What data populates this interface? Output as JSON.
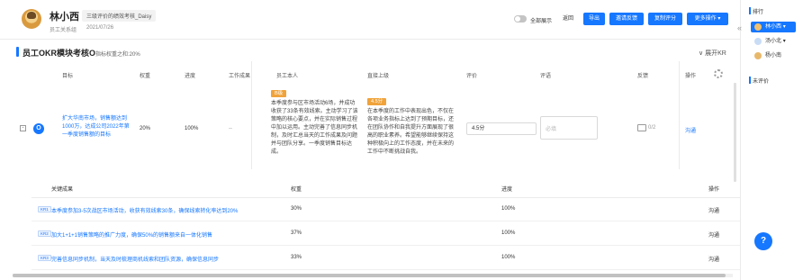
{
  "header": {
    "name": "林小西",
    "cycle_tag": "三级评价的绩效考核_Daisy",
    "dept": "员工关系组",
    "date": "2021/07/26",
    "toggle_label": "全部展示",
    "back_label": "返回",
    "export_label": "导出",
    "invite_label": "邀请反馈",
    "copy_label": "复制评分",
    "more_label": "更多操作",
    "more_icon": "chevron-down-icon"
  },
  "section": {
    "title": "员工OKR模块考核O",
    "subtitle": "指标权重之和:20%",
    "expand_label": "展开KR"
  },
  "table": {
    "headers": [
      "目标",
      "权重",
      "进度",
      "工作成果",
      "员工本人",
      "直接上级",
      "评价",
      "评语",
      "反馈",
      "操作"
    ]
  },
  "objective": {
    "collapse_symbol": "-",
    "badge": "O",
    "text": "扩大华南市场，销售额达到1000万，达成公司2022年第一季度销售额的目标",
    "weight": "20%",
    "progress": "100%",
    "result": "--",
    "self_tag": "B级",
    "self_tag_color": "#f0a33b",
    "self_text": "本季度参与区市场活动6场，并成功收获了33条有效线索。主动学习了该策略的核心要点，并在实际销售过程中加以运用。主动完善了信息同步机制，及时汇总当天的工作成果及问题并与团队分享。一季度销售目标达成。",
    "leader_tag": "4.5分",
    "leader_tag_color": "#f0a33b",
    "leader_text": "在本季度的工作中表现出色，不仅在各项业务指标上达到了预期目标，还在团队协作和自我提升方面展现了很高的职业素养。希望能够继续保持这种积极向上的工作态度，并在未来的工作中不断挑战自我。",
    "score": "4.5分",
    "comment_placeholder": "必填",
    "feedback_count": "0/2",
    "action": "沟通"
  },
  "kr_table": {
    "headers": [
      "关键成果",
      "权重",
      "进度",
      "操作"
    ],
    "rows": [
      {
        "badge": "KR1",
        "text": "本季度参加3-5次战区市场活动，收获有效线索30条，确保线索转化率达到20%",
        "weight": "30%",
        "progress": "100%",
        "action": "沟通"
      },
      {
        "badge": "KR2",
        "text": "加大1+1+1销售策略的推广力度，确保50%的销售额来自一体化销售",
        "weight": "37%",
        "progress": "100%",
        "action": "沟通"
      },
      {
        "badge": "KR3",
        "text": "完善信息同步机制，当天及时梳理商机线索和团队资源，确保信息同步",
        "weight": "33%",
        "progress": "100%",
        "action": "沟通"
      }
    ]
  },
  "sidebar": {
    "collapse_symbol": "«",
    "rank_title": "排行",
    "items": [
      {
        "name": "林小西",
        "arrow": "▾"
      },
      {
        "name": "汤小北",
        "arrow": "▾"
      },
      {
        "name": "杨小南",
        "arrow": ""
      }
    ],
    "unrated_title": "未评价",
    "help_symbol": "?"
  },
  "colors": {
    "accent": "#1677ff",
    "tag_orange": "#f0a33b"
  }
}
